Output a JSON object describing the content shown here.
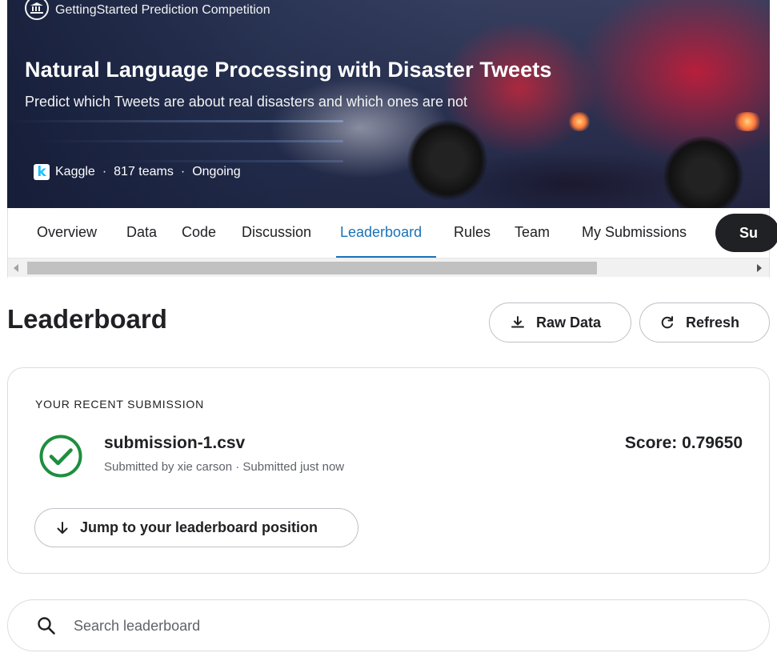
{
  "hero": {
    "competition_type": "GettingStarted Prediction Competition",
    "title": "Natural Language Processing with Disaster Tweets",
    "subtitle": "Predict which Tweets are about real disasters and which ones are not",
    "host": "Kaggle",
    "teams": "817 teams",
    "status": "Ongoing",
    "separator": "·",
    "host_logo_letter": "k"
  },
  "tabs": [
    {
      "label": "Overview"
    },
    {
      "label": "Data"
    },
    {
      "label": "Code"
    },
    {
      "label": "Discussion"
    },
    {
      "label": "Leaderboard",
      "active": true
    },
    {
      "label": "Rules"
    },
    {
      "label": "Team"
    },
    {
      "label": "My Submissions"
    }
  ],
  "submit_button": {
    "label": "Su"
  },
  "leaderboard": {
    "title": "Leaderboard",
    "raw_data_label": "Raw Data",
    "refresh_label": "Refresh"
  },
  "recent_submission": {
    "section_label": "YOUR RECENT SUBMISSION",
    "file_name": "submission-1.csv",
    "meta": "Submitted by xie carson · Submitted just now",
    "score_text": "Score: 0.79650",
    "jump_label": "Jump to your leaderboard position"
  },
  "search": {
    "placeholder": "Search leaderboard"
  },
  "colors": {
    "accent": "#1a73b8",
    "success": "#1e8e3e",
    "dark_button": "#202124",
    "kaggle_blue": "#20beff"
  },
  "icons": {
    "competition": "bank-icon",
    "download": "download-icon",
    "refresh": "refresh-icon",
    "status": "check-circle-icon",
    "jump": "arrow-down-icon",
    "search": "search-icon"
  }
}
